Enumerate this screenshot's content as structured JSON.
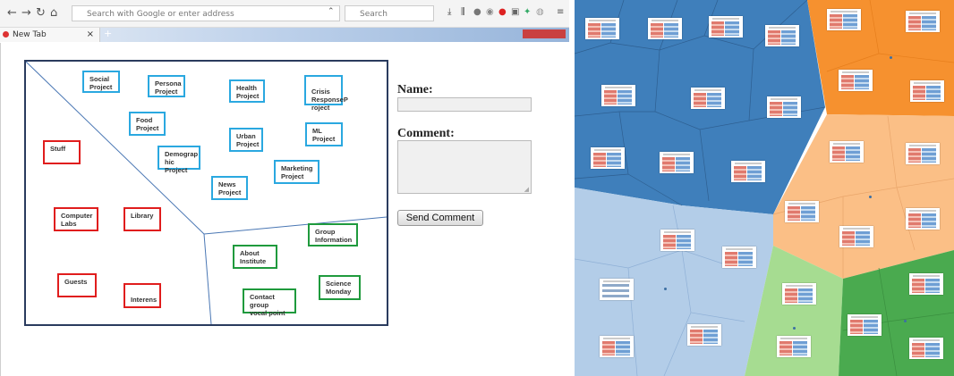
{
  "browser": {
    "url_text": "Search with Google or enter address",
    "search_placeholder": "Search",
    "tab_title": "New Tab",
    "tab_close": "×",
    "new_tab": "+"
  },
  "canvas": {
    "blue_boxes": [
      {
        "id": "social-project",
        "label": "Social\nProject"
      },
      {
        "id": "persona-project",
        "label": "Persona\nProject"
      },
      {
        "id": "health-project",
        "label": "Health\nProject"
      },
      {
        "id": "crisis-project",
        "label": "Crisis\nResponseP\nroject"
      },
      {
        "id": "food-project",
        "label": "Food\nProject"
      },
      {
        "id": "urban-project",
        "label": "Urban\nProject"
      },
      {
        "id": "ml-project",
        "label": "ML\nProject"
      },
      {
        "id": "demographic-project",
        "label": "Demograp\nhic Project"
      },
      {
        "id": "marketing-project",
        "label": "Marketing\nProject"
      },
      {
        "id": "news-project",
        "label": "News\nProject"
      }
    ],
    "red_boxes": [
      {
        "id": "stuff",
        "label": "Stuff"
      },
      {
        "id": "computer-labs",
        "label": "Computer\nLabs"
      },
      {
        "id": "library",
        "label": "Library"
      },
      {
        "id": "guests",
        "label": "Guests"
      },
      {
        "id": "interens",
        "label": "Interens"
      }
    ],
    "green_boxes": [
      {
        "id": "group-information",
        "label": "Group\nInformation"
      },
      {
        "id": "about-institute",
        "label": "About\nInstitute"
      },
      {
        "id": "science-monday",
        "label": "Science\nMonday"
      },
      {
        "id": "contact-group",
        "label": "Contact group\nvocal point"
      }
    ]
  },
  "form": {
    "name_label": "Name:",
    "comment_label": "Comment:",
    "send_label": "Send Comment"
  },
  "colors": {
    "blue_region": "#3f7fbb",
    "orange_region": "#f6912f",
    "light_orange_region": "#fbbf86",
    "light_blue_region": "#b3cde8",
    "green_region": "#4aaa4f",
    "light_green_region": "#a6dc91"
  }
}
